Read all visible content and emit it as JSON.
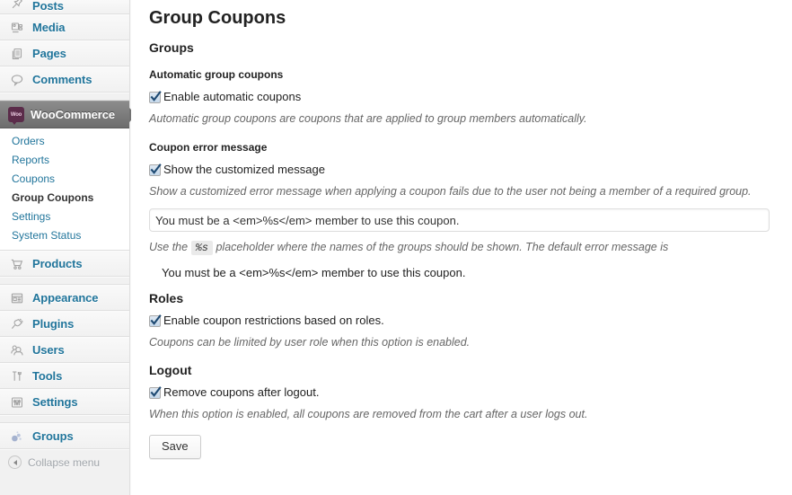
{
  "sidebar": {
    "items": [
      {
        "label": "Posts",
        "icon": "pin-icon",
        "clipped": true
      },
      {
        "label": "Media",
        "icon": "media-icon",
        "clipped": false
      },
      {
        "label": "Pages",
        "icon": "pages-icon",
        "clipped": false
      },
      {
        "label": "Comments",
        "icon": "comment-icon",
        "clipped": false
      }
    ],
    "current_item": {
      "label": "WooCommerce",
      "icon": "woocommerce-icon",
      "badge_text": "Woo"
    },
    "submenu": [
      {
        "label": "Orders",
        "active": false
      },
      {
        "label": "Reports",
        "active": false
      },
      {
        "label": "Coupons",
        "active": false
      },
      {
        "label": "Group Coupons",
        "active": true
      },
      {
        "label": "Settings",
        "active": false
      },
      {
        "label": "System Status",
        "active": false
      }
    ],
    "items_lower": [
      {
        "label": "Products",
        "icon": "cart-icon"
      },
      {
        "label": "Appearance",
        "icon": "appearance-icon"
      },
      {
        "label": "Plugins",
        "icon": "plug-icon"
      },
      {
        "label": "Users",
        "icon": "users-icon"
      },
      {
        "label": "Tools",
        "icon": "tools-icon"
      },
      {
        "label": "Settings",
        "icon": "settings-icon"
      }
    ],
    "items_plugin": [
      {
        "label": "Groups",
        "icon": "groups-icon"
      }
    ],
    "collapse": {
      "label": "Collapse menu",
      "icon": "collapse-arrow-icon"
    },
    "link_color": "#21759b",
    "current_bg": "#6d6d6d"
  },
  "main": {
    "page_title": "Group Coupons",
    "sections": {
      "groups": {
        "title": "Groups",
        "automatic": {
          "subtitle": "Automatic group coupons",
          "checkbox_label": "Enable automatic coupons",
          "checked": true,
          "description": "Automatic group coupons are coupons that are applied to group members automatically."
        },
        "error_message": {
          "subtitle": "Coupon error message",
          "checkbox_label": "Show the customized message",
          "checked": true,
          "description": "Show a customized error message when applying a coupon fails due to the user not being a member of a required group.",
          "input_value": "You must be a <em>%s</em> member to use this coupon.",
          "input_placeholder": "You must be a <em>%s</em> member to use this coupon.",
          "hint_before": "Use the",
          "hint_code": "%s",
          "hint_after": "placeholder where the names of the groups should be shown. The default error message is",
          "default_message": "You must be a <em>%s</em> member to use this coupon."
        }
      },
      "roles": {
        "title": "Roles",
        "checkbox_label": "Enable coupon restrictions based on roles.",
        "checked": true,
        "description": "Coupons can be limited by user role when this option is enabled."
      },
      "logout": {
        "title": "Logout",
        "checkbox_label": "Remove coupons after logout.",
        "checked": true,
        "description": "When this option is enabled, all coupons are removed from the cart after a user logs out."
      }
    },
    "save_label": "Save"
  }
}
